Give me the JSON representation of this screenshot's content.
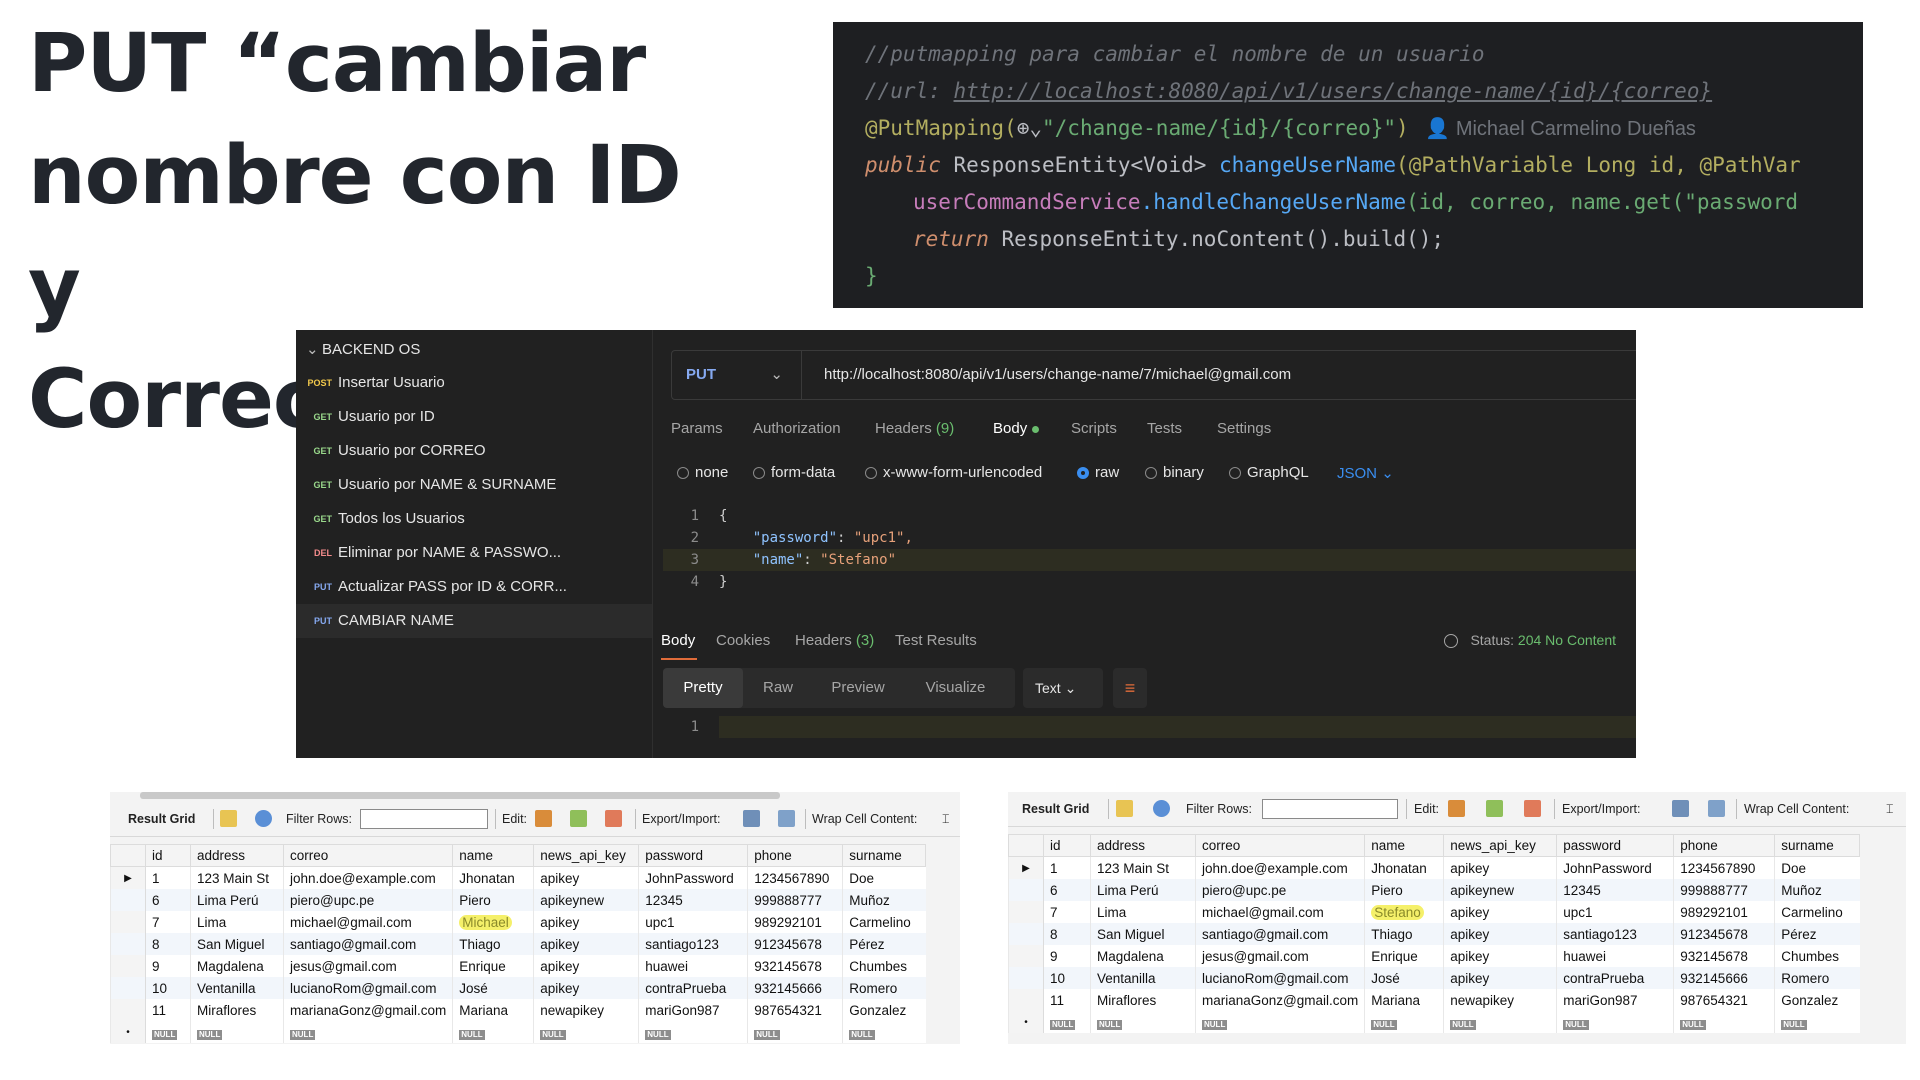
{
  "slide": {
    "title_lines": [
      "PUT “cambiar",
      "nombre con ID y",
      "Correo”"
    ]
  },
  "code": {
    "line1": "//putmapping para cambiar el nombre de un usuario",
    "line2_prefix": "//url: ",
    "line2_url": "http://localhost:8080/api/v1/users/change-name/{id}/{correo}",
    "line3_ann": "@PutMapping(",
    "line3_str": "\"/change-name/{id}/{correo}\"",
    "line3_close": ")",
    "author": "Michael Carmelino Dueñas",
    "line4_kw": "public ",
    "line4_type": "ResponseEntity<Void> ",
    "line4_fn": "changeUserName",
    "line4_rest": "(@PathVariable Long id, @PathVar",
    "line5_var": "userCommandService",
    "line5_fn": ".handleChangeUserName",
    "line5_rest": "(id, correo, name.get(\"password",
    "line6_kw": "return ",
    "line6_rest": "ResponseEntity.noContent().build();",
    "line7": "}"
  },
  "postman": {
    "collection": "BACKEND OS",
    "items": [
      {
        "method": "POST",
        "label": "Insertar Usuario"
      },
      {
        "method": "GET",
        "label": "Usuario por ID"
      },
      {
        "method": "GET",
        "label": "Usuario por CORREO"
      },
      {
        "method": "GET",
        "label": "Usuario por NAME & SURNAME"
      },
      {
        "method": "GET",
        "label": "Todos los Usuarios"
      },
      {
        "method": "DEL",
        "label": "Eliminar por NAME & PASSWO..."
      },
      {
        "method": "PUT",
        "label": "Actualizar PASS por ID & CORR..."
      },
      {
        "method": "PUT",
        "label": "CAMBIAR NAME"
      }
    ],
    "method": "PUT",
    "url": "http://localhost:8080/api/v1/users/change-name/7/michael@gmail.com",
    "req_tabs": {
      "params": "Params",
      "auth": "Authorization",
      "headers": "Headers",
      "headers_count": "(9)",
      "body": "Body",
      "scripts": "Scripts",
      "tests": "Tests",
      "settings": "Settings"
    },
    "body_types": {
      "none": "none",
      "form": "form-data",
      "urlenc": "x-www-form-urlencoded",
      "raw": "raw",
      "binary": "binary",
      "graphql": "GraphQL",
      "json": "JSON"
    },
    "body_lines": [
      {
        "n": "1",
        "t": "{"
      },
      {
        "n": "2",
        "key": "\"password\"",
        "val": "\"upc1\","
      },
      {
        "n": "3",
        "key": "\"name\"",
        "val": "\"Stefano\""
      },
      {
        "n": "4",
        "t": "}"
      }
    ],
    "resp_tabs": {
      "body": "Body",
      "cookies": "Cookies",
      "headers": "Headers",
      "headers_count": "(3)",
      "tests": "Test Results"
    },
    "status_label": "Status:",
    "status_value": "204 No Content",
    "view": {
      "pretty": "Pretty",
      "raw": "Raw",
      "preview": "Preview",
      "visualize": "Visualize",
      "text": "Text"
    },
    "resp_line": "1"
  },
  "grid_toolbar": {
    "result": "Result Grid",
    "filter": "Filter Rows:",
    "edit": "Edit:",
    "export": "Export/Import:",
    "wrap": "Wrap Cell Content:"
  },
  "grid_columns": [
    "id",
    "address",
    "correo",
    "name",
    "news_api_key",
    "password",
    "phone",
    "surname"
  ],
  "grid_before": [
    [
      "1",
      "123 Main St",
      "john.doe@example.com",
      "Jhonatan",
      "apikey",
      "JohnPassword",
      "1234567890",
      "Doe"
    ],
    [
      "6",
      "Lima Perú",
      "piero@upc.pe",
      "Piero",
      "apikeynew",
      "12345",
      "999888777",
      "Muñoz"
    ],
    [
      "7",
      "Lima",
      "michael@gmail.com",
      "Michael",
      "apikey",
      "upc1",
      "989292101",
      "Carmelino"
    ],
    [
      "8",
      "San Miguel",
      "santiago@gmail.com",
      "Thiago",
      "apikey",
      "santiago123",
      "912345678",
      "Pérez"
    ],
    [
      "9",
      "Magdalena",
      "jesus@gmail.com",
      "Enrique",
      "apikey",
      "huawei",
      "932145678",
      "Chumbes"
    ],
    [
      "10",
      "Ventanilla",
      "lucianoRom@gmail.com",
      "José",
      "apikey",
      "contraPrueba",
      "932145666",
      "Romero"
    ],
    [
      "11",
      "Miraflores",
      "marianaGonz@gmail.com",
      "Mariana",
      "newapikey",
      "mariGon987",
      "987654321",
      "Gonzalez"
    ]
  ],
  "grid_after": [
    [
      "1",
      "123 Main St",
      "john.doe@example.com",
      "Jhonatan",
      "apikey",
      "JohnPassword",
      "1234567890",
      "Doe"
    ],
    [
      "6",
      "Lima Perú",
      "piero@upc.pe",
      "Piero",
      "apikeynew",
      "12345",
      "999888777",
      "Muñoz"
    ],
    [
      "7",
      "Lima",
      "michael@gmail.com",
      "Stefano",
      "apikey",
      "upc1",
      "989292101",
      "Carmelino"
    ],
    [
      "8",
      "San Miguel",
      "santiago@gmail.com",
      "Thiago",
      "apikey",
      "santiago123",
      "912345678",
      "Pérez"
    ],
    [
      "9",
      "Magdalena",
      "jesus@gmail.com",
      "Enrique",
      "apikey",
      "huawei",
      "932145678",
      "Chumbes"
    ],
    [
      "10",
      "Ventanilla",
      "lucianoRom@gmail.com",
      "José",
      "apikey",
      "contraPrueba",
      "932145666",
      "Romero"
    ],
    [
      "11",
      "Miraflores",
      "marianaGonz@gmail.com",
      "Mariana",
      "newapikey",
      "mariGon987",
      "987654321",
      "Gonzalez"
    ]
  ],
  "null_label": "NULL",
  "colors": {
    "accent_put": "#86a9f0",
    "status_ok": "#6abd6e",
    "highlight": "#f5f06a"
  }
}
